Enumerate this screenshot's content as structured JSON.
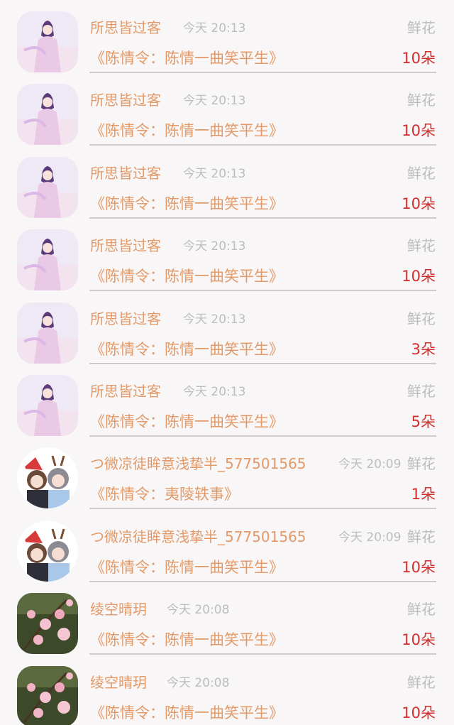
{
  "records": [
    {
      "avatar": "girl-purple-avatar",
      "name": "所思皆过客",
      "time": "今天 20:13",
      "gift": "鲜花",
      "book": "《陈情令：陈情一曲笑平生》",
      "count": "10朵"
    },
    {
      "avatar": "girl-purple-avatar",
      "name": "所思皆过客",
      "time": "今天 20:13",
      "gift": "鲜花",
      "book": "《陈情令：陈情一曲笑平生》",
      "count": "10朵"
    },
    {
      "avatar": "girl-purple-avatar",
      "name": "所思皆过客",
      "time": "今天 20:13",
      "gift": "鲜花",
      "book": "《陈情令：陈情一曲笑平生》",
      "count": "10朵"
    },
    {
      "avatar": "girl-purple-avatar",
      "name": "所思皆过客",
      "time": "今天 20:13",
      "gift": "鲜花",
      "book": "《陈情令：陈情一曲笑平生》",
      "count": "10朵"
    },
    {
      "avatar": "girl-purple-avatar",
      "name": "所思皆过客",
      "time": "今天 20:13",
      "gift": "鲜花",
      "book": "《陈情令：陈情一曲笑平生》",
      "count": "3朵"
    },
    {
      "avatar": "girl-purple-avatar",
      "name": "所思皆过客",
      "time": "今天 20:13",
      "gift": "鲜花",
      "book": "《陈情令：陈情一曲笑平生》",
      "count": "5朵"
    },
    {
      "avatar": "anime-couple-avatar",
      "name": "つ微凉徒眸意浅挚半_577501565",
      "time": "今天 20:09",
      "gift": "鲜花",
      "book": "《陈情令：夷陵轶事》",
      "count": "1朵"
    },
    {
      "avatar": "anime-couple-avatar",
      "name": "つ微凉徒眸意浅挚半_577501565",
      "time": "今天 20:09",
      "gift": "鲜花",
      "book": "《陈情令：陈情一曲笑平生》",
      "count": "10朵"
    },
    {
      "avatar": "peach-blossom-avatar",
      "name": "绫空晴玥",
      "time": "今天 20:08",
      "gift": "鲜花",
      "book": "《陈情令：陈情一曲笑平生》",
      "count": "10朵"
    },
    {
      "avatar": "peach-blossom-avatar",
      "name": "绫空晴玥",
      "time": "今天 20:08",
      "gift": "鲜花",
      "book": "《陈情令：陈情一曲笑平生》",
      "count": "10朵"
    }
  ]
}
